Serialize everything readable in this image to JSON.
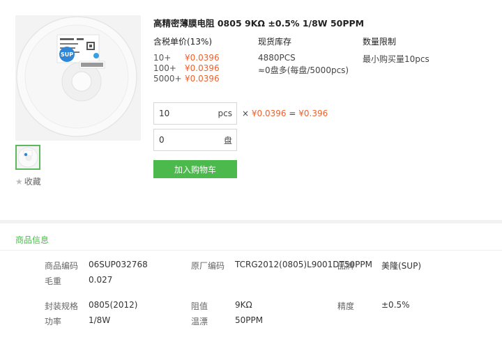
{
  "product": {
    "title": "高精密薄膜电阻 0805 9KΩ ±0.5% 1/8W 50PPM",
    "image_label": "SUP"
  },
  "favorite": {
    "icon": "star-icon",
    "label": "收藏"
  },
  "pricing": {
    "header": "含税单价(13%)",
    "tiers": [
      {
        "qty": "10+",
        "price": "¥0.0396"
      },
      {
        "qty": "100+",
        "price": "¥0.0396"
      },
      {
        "qty": "5000+",
        "price": "¥0.0396"
      }
    ]
  },
  "stock": {
    "header": "现货库存",
    "count": "4880PCS",
    "reels": "≈0盘多(每盘/5000pcs)"
  },
  "limit": {
    "header": "数量限制",
    "min": "最小购买量10pcs"
  },
  "order": {
    "pcs_value": "10",
    "pcs_unit": "pcs",
    "reel_value": "0",
    "reel_unit": "盘",
    "times": "×",
    "unit_price": "¥0.0396",
    "equals": "=",
    "total": "¥0.396",
    "add_cart_label": "加入购物车"
  },
  "info": {
    "section_title": "商品信息",
    "specs": {
      "code_label": "商品编码",
      "code_value": "06SUP032768",
      "mfr_code_label": "原厂编码",
      "mfr_code_value": "TCRG2012(0805)L9001DT50PPM",
      "brand_label": "品牌",
      "brand_value": "美隆(SUP)",
      "weight_label": "毛重",
      "weight_value": "0.027",
      "package_label": "封装规格",
      "package_value": "0805(2012)",
      "resistance_label": "阻值",
      "resistance_value": "9KΩ",
      "precision_label": "精度",
      "precision_value": "±0.5%",
      "power_label": "功率",
      "power_value": "1/8W",
      "tempco_label": "温漂",
      "tempco_value": "50PPM"
    }
  },
  "colors": {
    "accent_green": "#4cb94c",
    "price_orange": "#f0602a"
  }
}
